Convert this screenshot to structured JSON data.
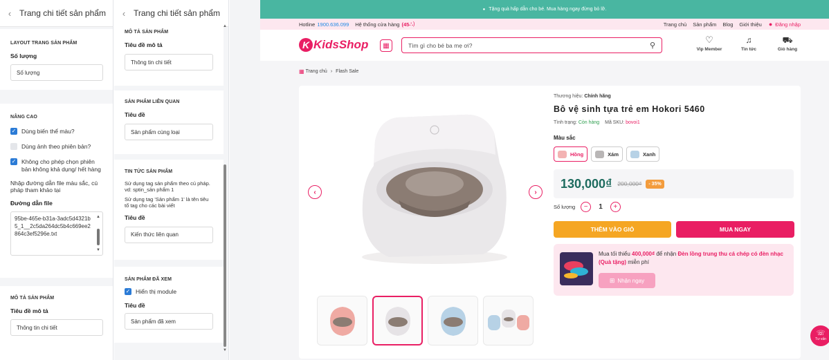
{
  "panel1": {
    "title": "Trang chi tiết sản phẩm",
    "layout": {
      "section": "LAYOUT TRANG SẢN PHẨM",
      "quantity_label": "Số lượng",
      "quantity_value": "Số lượng"
    },
    "advanced": {
      "section": "NÂNG CAO",
      "opt_variant_color": "Dùng biến thể màu?",
      "opt_version_image": "Dùng ảnh theo phiên bản?",
      "opt_disable_outofstock": "Không cho phép chọn phiên bản không khả dụng/ hết hàng",
      "hint": "Nhập đường dẫn file màu sắc, cú pháp tham khảo tại",
      "path_label": "Đường dẫn file",
      "path_value": "95be-465e-b31a-3adc5d4321b5_1__2c5da264dc5b4c669ee2864c3ef5296e.txt"
    },
    "description": {
      "section": "MÔ TẢ SẢN PHẨM",
      "title_label": "Tiêu đề mô tả",
      "title_value": "Thông tin chi tiết"
    }
  },
  "panel2": {
    "title": "Trang chi tiết sản phẩm",
    "description": {
      "section": "MÔ TẢ SẢN PHẨM",
      "title_label": "Tiêu đề mô tả",
      "title_value": "Thông tin chi tiết"
    },
    "related": {
      "section": "SẢN PHẨM LIÊN QUAN",
      "title_label": "Tiêu đề",
      "title_value": "Sản phẩm cùng loại"
    },
    "news": {
      "section": "TIN TỨC SẢN PHẨM",
      "hint1": "Sử dụng tag sản phẩm theo cú pháp. vd: sptin_sản phẩm 1",
      "hint2": "Sử dụng tag 'Sản phẩm 1' là tên tiêu tổ tag cho các bài viết",
      "title_label": "Tiêu đề",
      "title_value": "Kiến thức liên quan"
    },
    "viewed": {
      "section": "SẢN PHẨM ĐÃ XEM",
      "show_module": "Hiển thị module",
      "title_label": "Tiêu đề",
      "title_value": "Sản phẩm đã xem"
    }
  },
  "site": {
    "promo": "Tặng quà hấp dẫn cho bé. Mua hàng ngay đừng bỏ lỡ.",
    "hotline_label": "Hotline",
    "hotline": "1900.636.099",
    "stores_label": "Hệ thống cửa hàng",
    "stores_count": "(45",
    "nav": [
      "Trang chủ",
      "Sản phẩm",
      "Blog",
      "Giới thiệu"
    ],
    "login": "Đăng nhập",
    "logo": "KidsShop",
    "search_placeholder": "Tìm gì cho bé ba mẹ ơi?",
    "icons": [
      {
        "label": "Vip Member",
        "icon": "heart-icon"
      },
      {
        "label": "Tin tức",
        "icon": "bell-icon"
      },
      {
        "label": "Giỏ hàng",
        "icon": "cart-icon"
      }
    ],
    "breadcrumb": {
      "home": "Trang chủ",
      "sep": "›",
      "current": "Flash Sale"
    },
    "brand_label": "Thương hiệu:",
    "brand": "Chính hãng",
    "product_name": "Bô vệ sinh tựa trẻ em Hokori 5460",
    "status_label": "Tình trạng:",
    "status": "Còn hàng",
    "sku_label": "Mã SKU:",
    "sku": "bovoi1",
    "color_label": "Màu sắc",
    "colors": [
      {
        "name": "Hồng",
        "hex": "#f3b3b3"
      },
      {
        "name": "Xám",
        "hex": "#b9b6b6"
      },
      {
        "name": "Xanh",
        "hex": "#b7d2e6"
      }
    ],
    "price": "130,000₫",
    "old_price": "200,000₫",
    "discount": "- 35%",
    "qty_label": "Số lượng",
    "qty": "1",
    "add_to_cart": "THÊM VÀO GIỎ",
    "buy_now": "MUA NGAY",
    "gift_text_1": "Mua tối thiểu",
    "gift_min": "400,000₫",
    "gift_text_2": "để nhận",
    "gift_item": "Đèn lồng trung thu cá chép có đèn nhạc (Quà tặng)",
    "gift_text_3": "miễn phí",
    "gift_button": "Nhận ngay",
    "chat_label": "Tư vấn",
    "colors_theme": {
      "brand": "#e91e63",
      "teal": "#49b6a1",
      "orange": "#f5a623",
      "price": "#1d6b5e"
    }
  }
}
